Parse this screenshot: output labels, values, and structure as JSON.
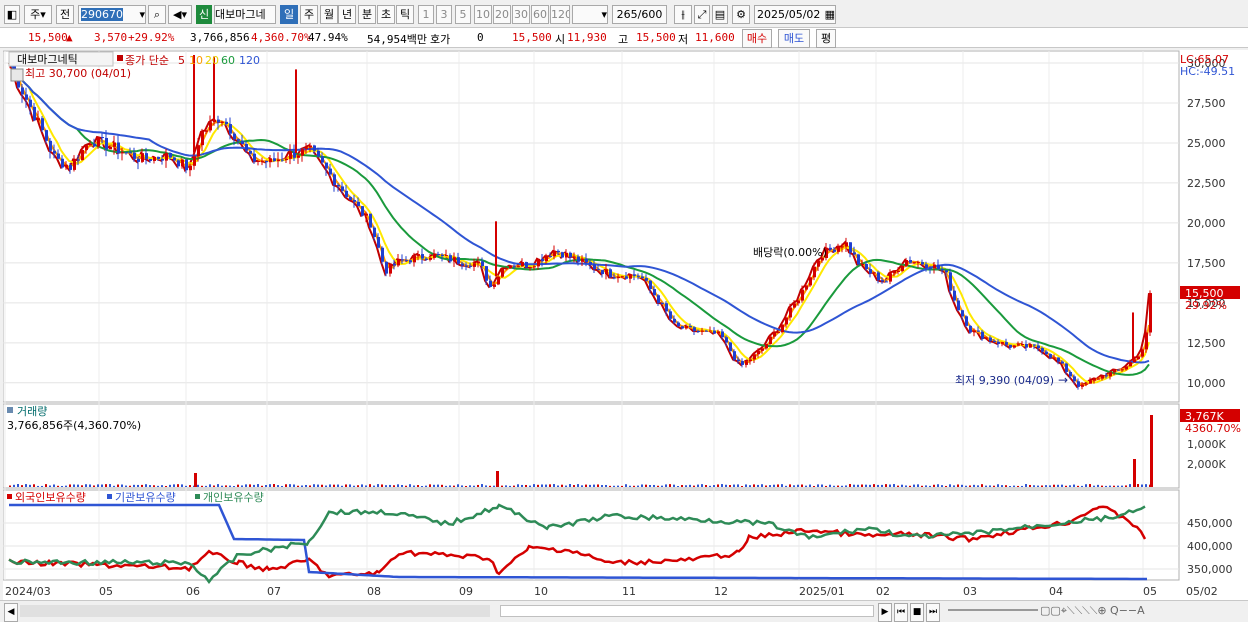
{
  "toolbar": {
    "period": "주",
    "compare": "전",
    "code": "290670",
    "sin": "신",
    "name": "대보마그네",
    "tabs": [
      "일",
      "주",
      "월",
      "년",
      "분",
      "초",
      "틱"
    ],
    "nums": [
      "1",
      "3",
      "5",
      "10",
      "20",
      "30",
      "60",
      "120"
    ],
    "count": "265",
    "count_total": "/600",
    "date": "2025/05/02"
  },
  "quote": {
    "price": "15,500",
    "arrow": "▲",
    "change": "3,570",
    "change_pct": "+29.92%",
    "volume": "3,766,856",
    "vol_pct": "4,360.70%",
    "rate": "47.94%",
    "amount": "54,954백만",
    "hoga_label": "호가",
    "hoga_val": "0",
    "hoga_price": "15,500",
    "open_label": "시",
    "open": "11,930",
    "high_label": "고",
    "high": "15,500",
    "low_label": "저",
    "low": "11,600",
    "buy": "매수",
    "sell": "매도",
    "flat": "평"
  },
  "main": {
    "legend_name": "대보마그네틱",
    "legend_close": "종가 단순",
    "ma_labels": [
      "5",
      "10",
      "20",
      "60",
      "120"
    ],
    "ma_colors": [
      "#c00000",
      "#ff9900",
      "#ffe800",
      "#1a9a3c",
      "#2f55d4"
    ],
    "high_note": "최고 30,700 (04/01)",
    "low_note": "최저 9,390 (04/09)",
    "dividend_note": "배당락(0.00%)",
    "lc": "LC:65.07",
    "hc": "HC:-49.51",
    "yticks": [
      "30,000",
      "27,500",
      "25,000",
      "22,500",
      "20,000",
      "17,500",
      "15,000",
      "12,500",
      "10,000"
    ],
    "price_tag": "15,500",
    "pct_tag": "29.92%"
  },
  "volume": {
    "title": "거래량",
    "value": "3,766,856주(4,360.70%)",
    "tag": "3,767K",
    "tag_pct": "4360.70%",
    "yticks": [
      "2,000K",
      "1,000K"
    ]
  },
  "holding": {
    "series": [
      "외국인보유수량",
      "기관보유수량",
      "개인보유수량"
    ],
    "colors": [
      "#d40000",
      "#2f55d4",
      "#2e8b57"
    ],
    "yticks": [
      "450,000",
      "400,000",
      "350,000"
    ]
  },
  "xaxis": [
    "2024/03",
    "05",
    "06",
    "07",
    "08",
    "09",
    "10",
    "11",
    "12",
    "2025/01",
    "02",
    "03",
    "04",
    "05",
    "05/02"
  ]
}
